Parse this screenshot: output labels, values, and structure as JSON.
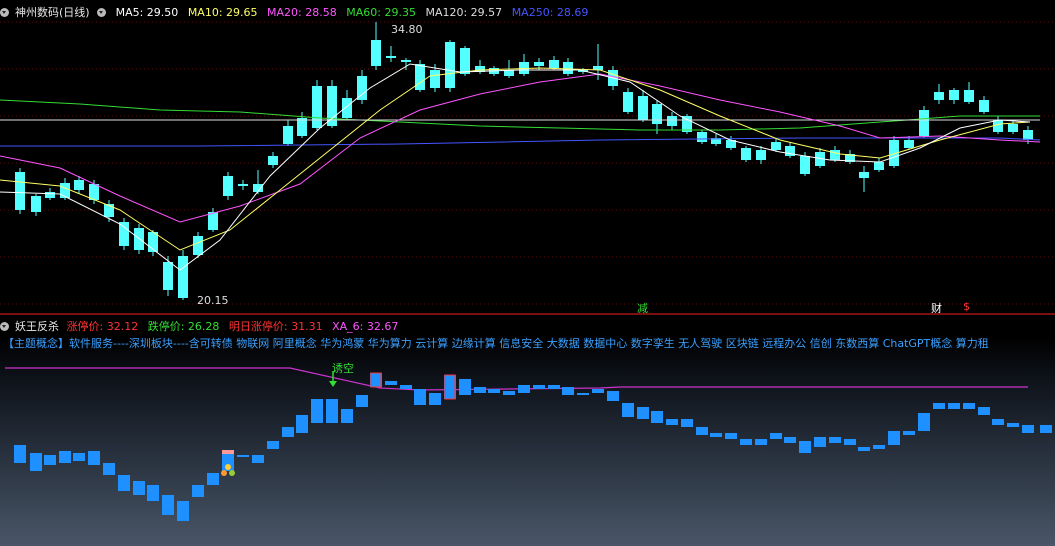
{
  "main": {
    "title": "神州数码(日线)",
    "indicators": [
      {
        "label": "MA5: 29.50",
        "color": "#ffffff"
      },
      {
        "label": "MA10: 29.65",
        "color": "#ffff66"
      },
      {
        "label": "MA20: 28.58",
        "color": "#ff55ff"
      },
      {
        "label": "MA60: 29.35",
        "color": "#33dd33"
      },
      {
        "label": "MA120: 29.57",
        "color": "#dddddd"
      },
      {
        "label": "MA250: 28.69",
        "color": "#4455ff"
      }
    ],
    "high_label": "34.80",
    "low_label": "20.15",
    "markers": [
      {
        "text": "减",
        "color": "#33dd33"
      },
      {
        "text": "财",
        "color": "#ffffff"
      },
      {
        "text": "$",
        "color": "#ff3333"
      }
    ]
  },
  "sub": {
    "title": "妖王反杀",
    "indicators": [
      {
        "label": "涨停价: 32.12",
        "color": "#ff3333"
      },
      {
        "label": "跌停价: 26.28",
        "color": "#33dd33"
      },
      {
        "label": "明日涨停价: 31.31",
        "color": "#ff3333"
      },
      {
        "label": "XA_6: 32.67",
        "color": "#ff55ff"
      }
    ],
    "concepts": "【主题概念】软件服务----深圳板块----含可转债 物联网 阿里概念 华为鸿蒙 华为算力 云计算 边缘计算 信息安全 大数据 数据中心 数字孪生 无人驾驶 区块链 远程办公 信创 东数西算 ChatGPT概念 算力租",
    "signal_label": "诱空"
  },
  "colors": {
    "up": "#ff3333",
    "down": "#54ffff",
    "sub_bar": "#1e90ff",
    "sub_line": "#cc33cc",
    "divider": "#7a1010"
  }
}
